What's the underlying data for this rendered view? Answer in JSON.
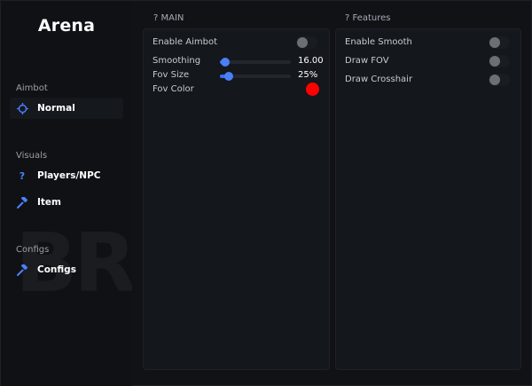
{
  "app": {
    "title": "Arena",
    "watermark": "BR"
  },
  "sidebar": {
    "sections": [
      {
        "title": "Aimbot",
        "items": [
          {
            "label": "Normal",
            "icon": "crosshair-icon",
            "active": true
          }
        ]
      },
      {
        "title": "Visuals",
        "items": [
          {
            "label": "Players/NPC",
            "icon": "question-icon",
            "icon_glyph": "?"
          },
          {
            "label": "Item",
            "icon": "hammer-icon"
          }
        ]
      },
      {
        "title": "Configs",
        "items": [
          {
            "label": "Configs",
            "icon": "hammer-icon"
          }
        ]
      }
    ]
  },
  "main": {
    "title": "? MAIN",
    "enable_aimbot": {
      "label": "Enable Aimbot",
      "on": false
    },
    "smoothing": {
      "label": "Smoothing",
      "value": "16.00",
      "fraction": 0.07
    },
    "fov_size": {
      "label": "Fov Size",
      "value": "25%",
      "fraction": 0.13
    },
    "fov_color": {
      "label": "Fov Color",
      "color": "#ff0000"
    }
  },
  "features": {
    "title": "? Features",
    "items": [
      {
        "label": "Enable Smooth",
        "on": false
      },
      {
        "label": "Draw FOV",
        "on": false
      },
      {
        "label": "Draw Crosshair",
        "on": false
      }
    ]
  },
  "colors": {
    "accent": "#3b6ff2",
    "background": "#101216",
    "panel": "#14171c",
    "toggle_off": "#6b6f76"
  }
}
